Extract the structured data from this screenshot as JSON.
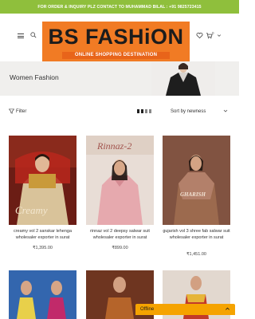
{
  "topbar": {
    "text": "FOR ORDER & INQUIRY PLZ CONTACT TO MUHAMMAD BILAL : +91 9825723415"
  },
  "logo": {
    "name": "BS FASHiON",
    "tagline": "ONLINE SHOPPING DESTINATION"
  },
  "header": {
    "cart_count": "0"
  },
  "banner": {
    "title": "Women Fashion"
  },
  "filterbar": {
    "filter_label": "Filter",
    "sort_label": "Sort by newness"
  },
  "products": [
    {
      "name": "creamy vol 2 sanskar lehenga wholesaler exporter in surat",
      "price": "₹1,395.00",
      "thumb_text": "Creamy"
    },
    {
      "name": "rinnaz vol 2 deepsy salwar suit wholesaler exporter in surat",
      "price": "₹899.00",
      "thumb_text": "Rinnaz-2"
    },
    {
      "name": "gujarish vol 3 shree fab salwar suit wholesaler exporter in surat",
      "price": "₹1,451.00",
      "thumb_text": "GHARISH"
    }
  ],
  "chat": {
    "status": "Offline"
  },
  "colors": {
    "topbar": "#8fbf3c",
    "logo_bg": "#f17b24",
    "chat_bg": "#f5a300"
  }
}
